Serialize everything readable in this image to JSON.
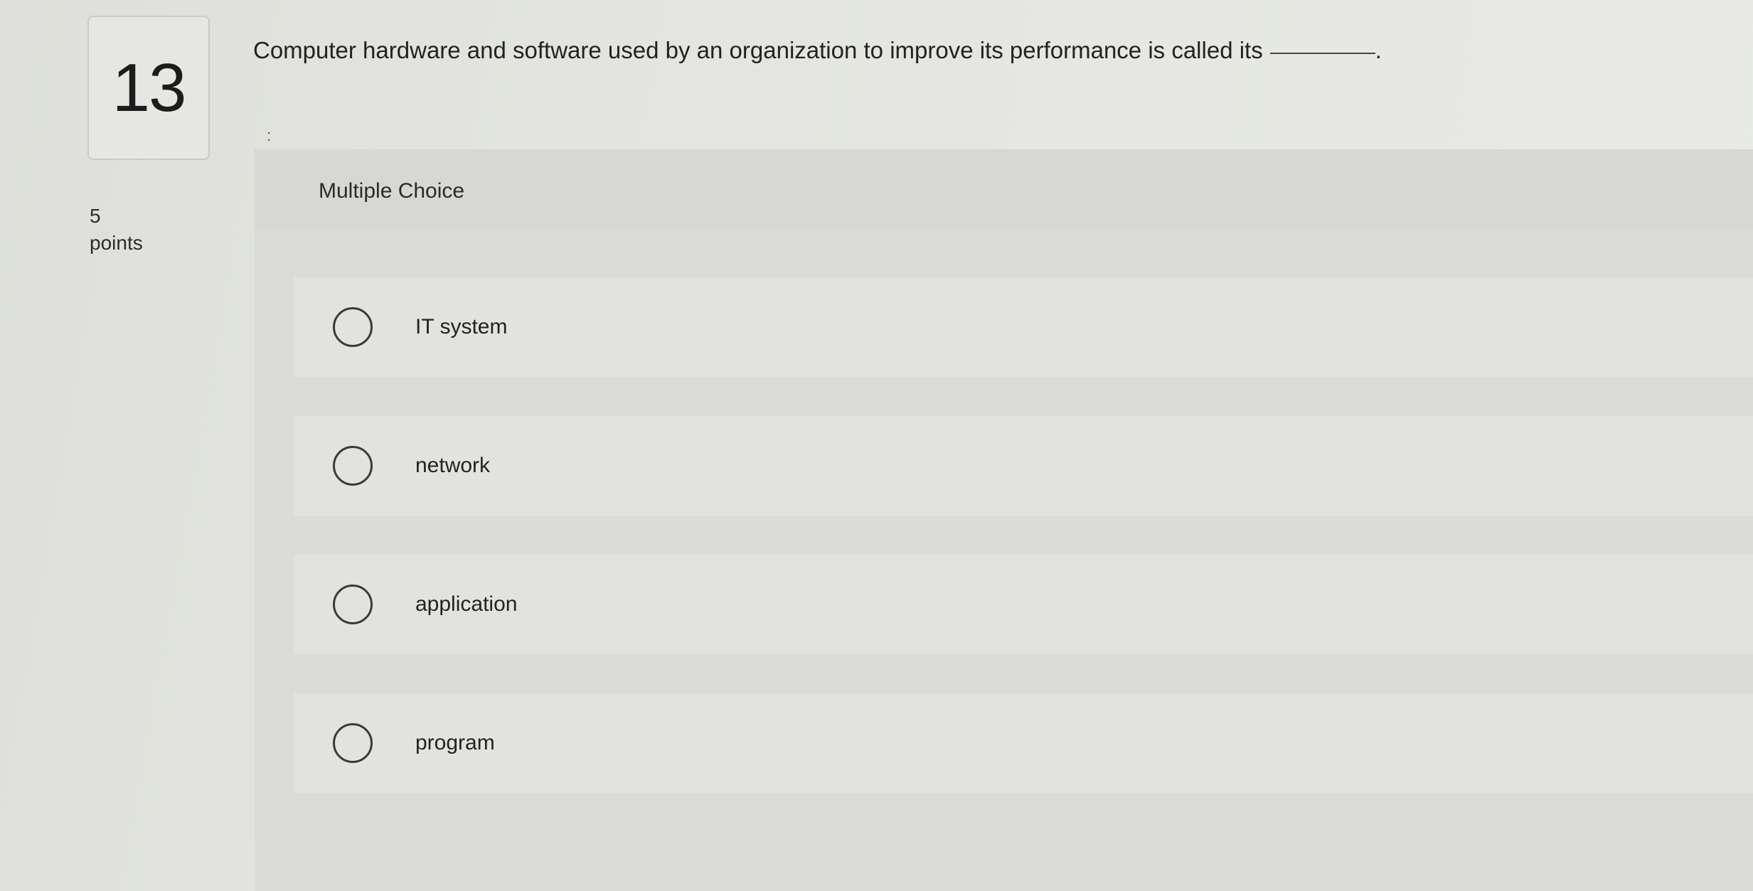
{
  "question": {
    "number": "13",
    "points_value": "5",
    "points_label": "points",
    "text": "Computer hardware and software used by an organization to improve its performance is called its",
    "blank_suffix": ".",
    "marker": ":"
  },
  "multiple_choice": {
    "title": "Multiple Choice",
    "options": [
      {
        "label": "IT system",
        "selected": false
      },
      {
        "label": "network",
        "selected": false
      },
      {
        "label": "application",
        "selected": false
      },
      {
        "label": "program",
        "selected": false
      }
    ]
  }
}
